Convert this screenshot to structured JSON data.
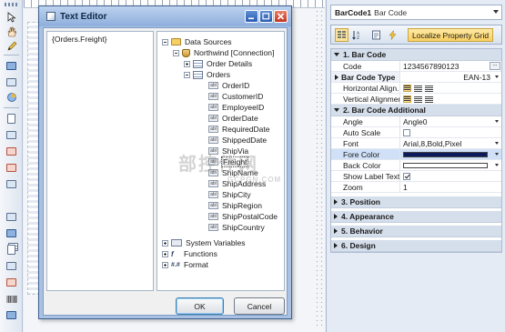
{
  "dialog": {
    "title": "Text Editor",
    "expression": "{Orders.Freight}",
    "ok_label": "OK",
    "cancel_label": "Cancel"
  },
  "tree": {
    "data_sources": "Data Sources",
    "connection": "Northwind [Connection]",
    "order_details": "Order Details",
    "orders": "Orders",
    "fields": [
      "OrderID",
      "CustomerID",
      "EmployeeID",
      "OrderDate",
      "RequiredDate",
      "ShippedDate",
      "ShipVia",
      "Freight",
      "ShipName",
      "ShipAddress",
      "ShipCity",
      "ShipRegion",
      "ShipPostalCode",
      "ShipCountry"
    ],
    "selected_field": "Freight",
    "system_variables": "System Variables",
    "functions": "Functions",
    "format": "Format"
  },
  "properties": {
    "object_name": "BarCode1",
    "object_type": "Bar Code",
    "localize_label": "Localize Property Grid",
    "categories": {
      "bar_code": "1. Bar Code",
      "bar_code_additional": "2. Bar Code  Additional",
      "position": "3. Position",
      "appearance": "4. Appearance",
      "behavior": "5. Behavior",
      "design": "6. Design"
    },
    "code_label": "Code",
    "code_value": "1234567890123",
    "bar_code_type_label": "Bar Code Type",
    "bar_code_type_value": "EAN-13",
    "horizontal_align_label": "Horizontal Align...",
    "vertical_align_label": "Vertical Alignment",
    "angle_label": "Angle",
    "angle_value": "Angle0",
    "auto_scale_label": "Auto Scale",
    "font_label": "Font",
    "font_value": "Arial,8,Bold,Pixel",
    "fore_color_label": "Fore Color",
    "fore_color": "#0a1a5c",
    "back_color_label": "Back Color",
    "back_color": "#ffffff",
    "show_label_text_label": "Show Label Text",
    "zoom_label": "Zoom",
    "zoom_value": "1"
  },
  "watermark": {
    "text": "部控件网",
    "sub": "GCPGN.COM"
  }
}
